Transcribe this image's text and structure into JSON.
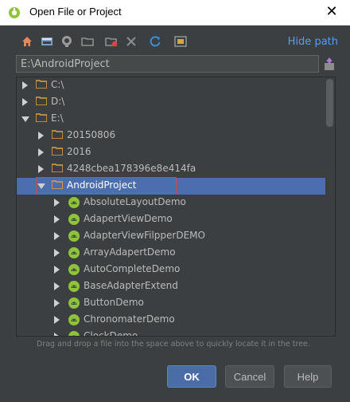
{
  "window": {
    "title": "Open File or Project",
    "close_glyph": "✕",
    "app_icon": "android-studio-icon"
  },
  "toolbar": {
    "icons": [
      "home-icon",
      "desktop-icon",
      "project-icon",
      "module-icon",
      "new-folder-icon",
      "delete-icon",
      "refresh-icon",
      "show-hidden-icon"
    ],
    "hide_path_label": "Hide path"
  },
  "path": {
    "value": "E:\\AndroidProject"
  },
  "tree": {
    "rows": [
      {
        "label": "C:\\",
        "depth": 0,
        "expanded": false,
        "kind": "folder"
      },
      {
        "label": "D:\\",
        "depth": 0,
        "expanded": false,
        "kind": "folder"
      },
      {
        "label": "E:\\",
        "depth": 0,
        "expanded": true,
        "kind": "folder"
      },
      {
        "label": "20150806",
        "depth": 1,
        "expanded": false,
        "kind": "folder"
      },
      {
        "label": "2016",
        "depth": 1,
        "expanded": false,
        "kind": "folder"
      },
      {
        "label": "4248cbea178396e8e414fa",
        "depth": 1,
        "expanded": false,
        "kind": "folder"
      },
      {
        "label": "AndroidProject",
        "depth": 1,
        "expanded": true,
        "kind": "folder",
        "selected": true
      },
      {
        "label": "AbsoluteLayoutDemo",
        "depth": 2,
        "expanded": false,
        "kind": "android"
      },
      {
        "label": "AdapertViewDemo",
        "depth": 2,
        "expanded": false,
        "kind": "android"
      },
      {
        "label": "AdapterViewFilpperDEMO",
        "depth": 2,
        "expanded": false,
        "kind": "android"
      },
      {
        "label": "ArrayAdapertDemo",
        "depth": 2,
        "expanded": false,
        "kind": "android"
      },
      {
        "label": "AutoCompleteDemo",
        "depth": 2,
        "expanded": false,
        "kind": "android"
      },
      {
        "label": "BaseAdapterExtend",
        "depth": 2,
        "expanded": false,
        "kind": "android"
      },
      {
        "label": "ButtonDemo",
        "depth": 2,
        "expanded": false,
        "kind": "android"
      },
      {
        "label": "ChronomaterDemo",
        "depth": 2,
        "expanded": false,
        "kind": "android"
      },
      {
        "label": "ClockDemo",
        "depth": 2,
        "expanded": false,
        "kind": "android"
      }
    ]
  },
  "hint": "Drag and drop a file into the space above to quickly locate it in the tree.",
  "buttons": {
    "ok": "OK",
    "cancel": "Cancel",
    "help": "Help"
  },
  "colors": {
    "accent": "#4b6eaf",
    "link": "#589df6",
    "folder": "#d9a343",
    "android": "#8fc33a",
    "highlight": "#e0433e"
  }
}
